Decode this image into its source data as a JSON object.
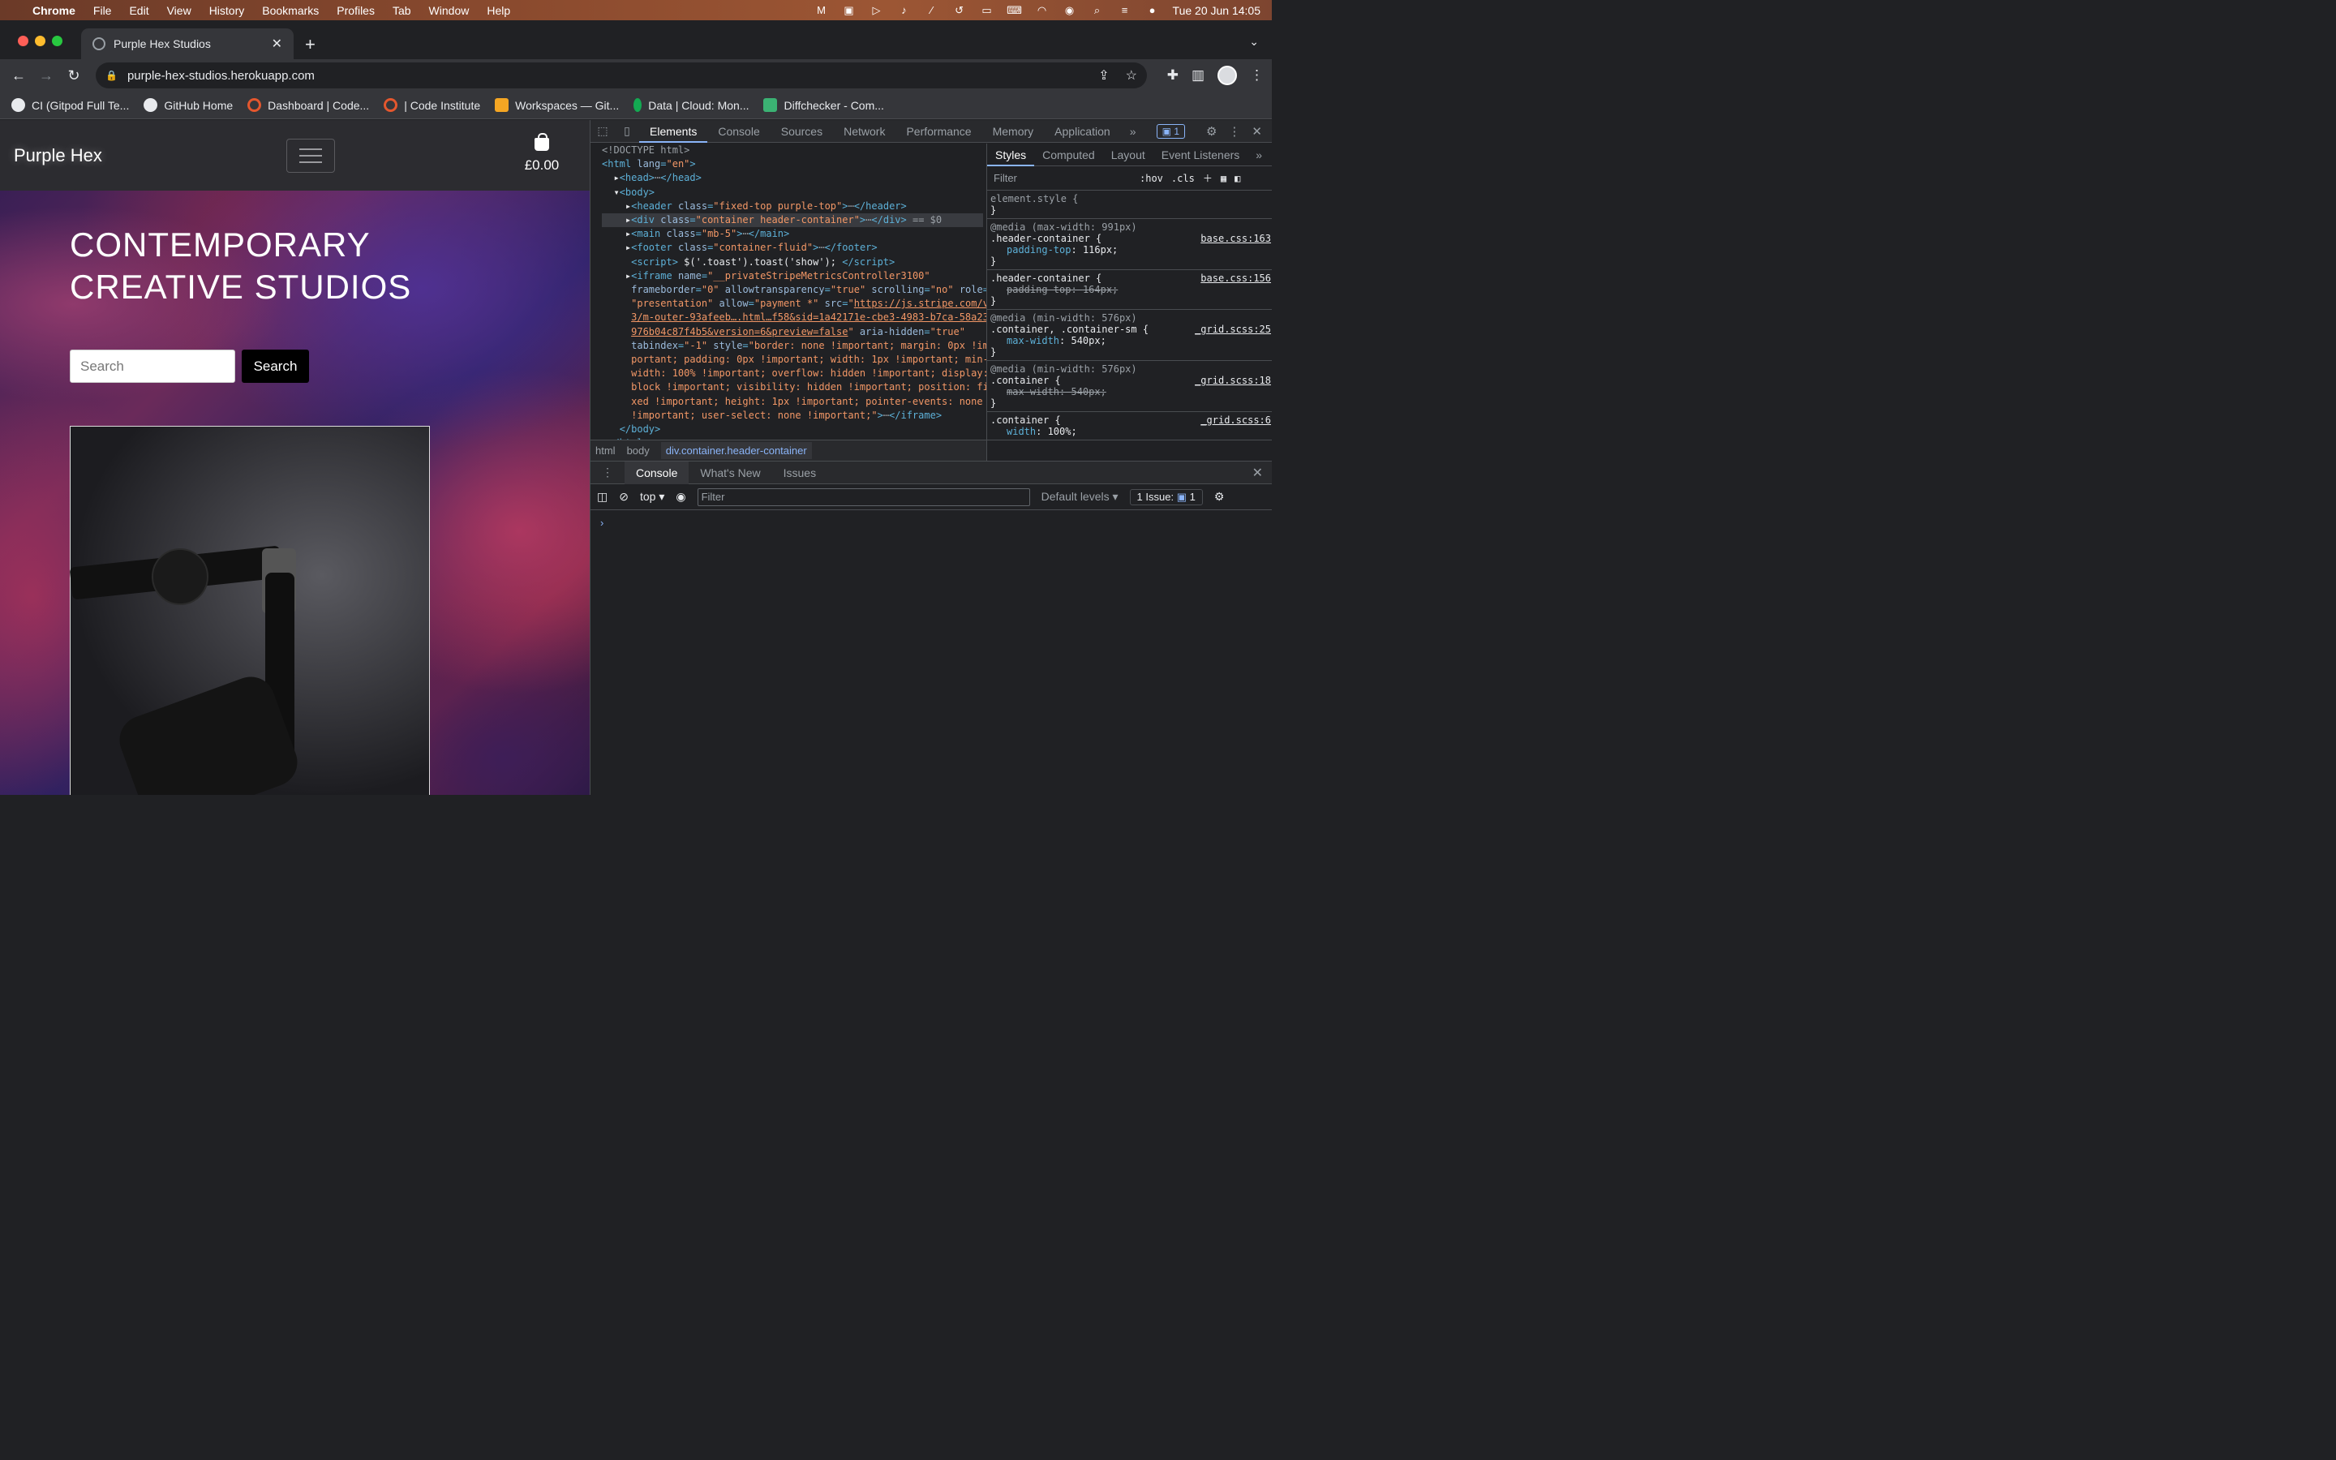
{
  "menubar": {
    "app": "Chrome",
    "items": [
      "File",
      "Edit",
      "View",
      "History",
      "Bookmarks",
      "Profiles",
      "Tab",
      "Window",
      "Help"
    ],
    "datetime": "Tue 20 Jun  14:05"
  },
  "browser": {
    "tab_title": "Purple Hex Studios",
    "url": "purple-hex-studios.herokuapp.com",
    "bookmarks": [
      {
        "label": "CI (Gitpod Full Te...",
        "color": "#e8eaed"
      },
      {
        "label": "GitHub Home",
        "color": "#e8eaed"
      },
      {
        "label": "Dashboard | Code...",
        "color": "#e4572e"
      },
      {
        "label": "| Code Institute",
        "color": "#e4572e"
      },
      {
        "label": "Workspaces — Git...",
        "color": "#f5a623"
      },
      {
        "label": "Data | Cloud: Mon...",
        "color": "#13aa52"
      },
      {
        "label": "Diffchecker - Com...",
        "color": "#3bb273"
      }
    ]
  },
  "site": {
    "brand": "Purple Hex",
    "cart_amount": "£0.00",
    "hero_title": "CONTEMPORARY CREATIVE STUDIOS",
    "search_placeholder": "Search",
    "search_button": "Search"
  },
  "devtools": {
    "tabs": [
      "Elements",
      "Console",
      "Sources",
      "Network",
      "Performance",
      "Memory",
      "Application"
    ],
    "issues_badge": "1",
    "breadcrumbs": [
      "html",
      "body",
      "div.container.header-container"
    ],
    "styles_tabs": [
      "Styles",
      "Computed",
      "Layout",
      "Event Listeners"
    ],
    "styles_filter": "Filter",
    "hov": ":hov",
    "cls": ".cls",
    "rules": [
      {
        "selector": "element.style {",
        "source": "",
        "media": "",
        "props": []
      },
      {
        "media": "@media (max-width: 991px)",
        "selector": ".header-container {",
        "source": "base.css:163",
        "props": [
          {
            "name": "padding-top",
            "value": "116px;",
            "struck": false
          }
        ]
      },
      {
        "media": "",
        "selector": ".header-container {",
        "source": "base.css:156",
        "props": [
          {
            "name": "padding-top",
            "value": "164px;",
            "struck": true
          }
        ]
      },
      {
        "media": "@media (min-width: 576px)",
        "selector": ".container, .container-sm {",
        "source": "_grid.scss:25",
        "props": [
          {
            "name": "max-width",
            "value": "540px;",
            "struck": false
          }
        ]
      },
      {
        "media": "@media (min-width: 576px)",
        "selector": ".container {",
        "source": "_grid.scss:18",
        "props": [
          {
            "name": "max-width",
            "value": "540px;",
            "struck": true
          }
        ]
      },
      {
        "media": "",
        "selector": ".container {",
        "source": "_grid.scss:6",
        "props": [
          {
            "name": "width",
            "value": "100%;",
            "struck": false
          }
        ]
      }
    ],
    "console_tabs": [
      "Console",
      "What's New",
      "Issues"
    ],
    "context": "top",
    "console_filter": "Filter",
    "levels": "Default levels",
    "issue_count": "1 Issue:",
    "issue_badge": "1"
  }
}
